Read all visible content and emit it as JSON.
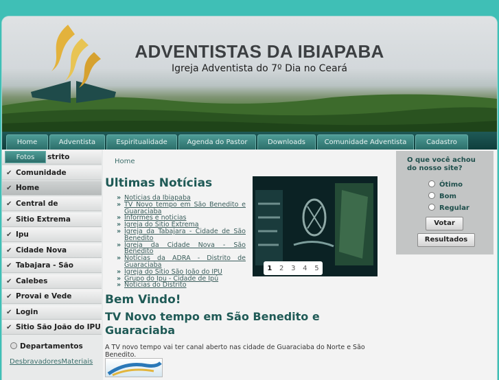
{
  "site": {
    "title": "ADVENTISTAS DA IBIAPABA",
    "subtitle": "Igreja Adventista do 7º Dia no Ceará"
  },
  "nav": {
    "tabs": [
      "Home",
      "Adventista",
      "Espiritualidade",
      "Agenda do Pastor",
      "Downloads",
      "Comunidade Adventista",
      "Cadastro"
    ],
    "sub_tab": "Fotos"
  },
  "sidebar": {
    "items": [
      "Distrito",
      "Comunidade",
      "Home",
      "Central de Guaraciaba",
      "Sitio Extrema",
      "Ipu",
      "Cidade Nova",
      "Tabajara - São",
      "Calebes",
      "Provai e Vede",
      "Login",
      "Sitio São João do IPU"
    ],
    "active": "Home",
    "departments_label": "Departamentos",
    "sublinks": [
      "Desbravadores",
      "Materiais"
    ]
  },
  "breadcrumb": "Home",
  "news": {
    "heading": "Ultimas Notícias",
    "items": [
      "Noticias da Ibiapaba",
      "TV Novo tempo em São Benedito e Guaraciaba",
      "Informes e noticias",
      "Igreja do Sitio Extrema",
      "Igreja da Tabajara - Cidade de São Benedito",
      "Igreja da Cidade Nova - São Benedito",
      "Notícias da ADRA - Distrito de Guaraciaba",
      "Igreja do Sitio São João do IPU",
      "Grupo do Ipu - Cidade de Ipú",
      "Notícias do Distrito"
    ]
  },
  "slideshow": {
    "pages": [
      "1",
      "2",
      "3",
      "4",
      "5"
    ],
    "current": "1"
  },
  "welcome_heading": "Bem Vindo!",
  "article": {
    "title": "TV Novo tempo em São Benedito e Guaraciaba",
    "text": "A TV novo tempo vai ter canal aberto nas cidade de Guaraciaba do Norte e São Benedito."
  },
  "poll": {
    "question": "O que você achou do nosso site?",
    "options": [
      "Ótimo",
      "Bom",
      "Regular"
    ],
    "vote_label": "Votar",
    "results_label": "Resultados"
  },
  "colors": {
    "page_bg": "#3fbfb6",
    "nav_bg": "#0f3e3c",
    "heading": "#1f5a56"
  }
}
